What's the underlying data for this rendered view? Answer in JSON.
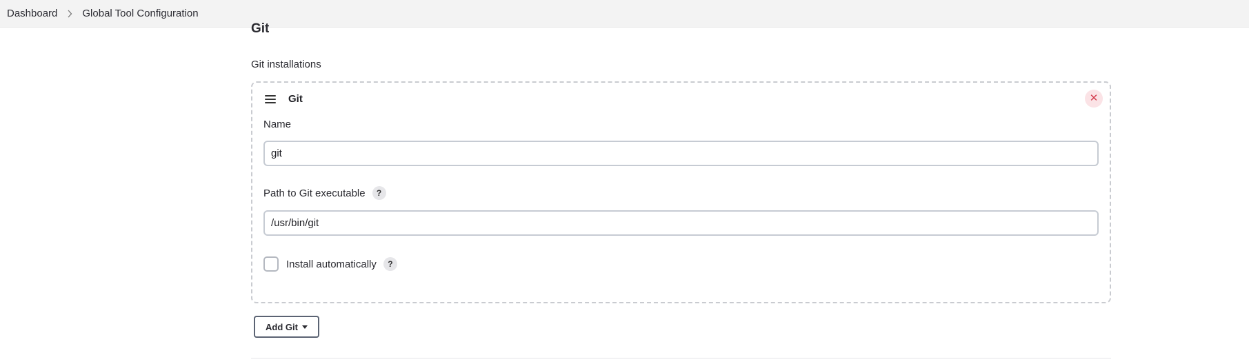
{
  "breadcrumb": {
    "items": [
      "Dashboard",
      "Global Tool Configuration"
    ]
  },
  "section": {
    "title": "Git",
    "installations_label": "Git installations"
  },
  "installation": {
    "title": "Git",
    "delete_symbol": "✕",
    "name_label": "Name",
    "name_value": "git",
    "path_label": "Path to Git executable",
    "path_value": "/usr/bin/git",
    "install_auto_label": "Install automatically",
    "install_auto_checked": false,
    "help_symbol": "?"
  },
  "actions": {
    "add_label": "Add Git"
  },
  "icons": {
    "drag": "drag-handle-icon",
    "delete": "close-icon",
    "help": "help-icon",
    "breadcrumb_separator": "chevron-right-icon",
    "dropdown": "caret-down-icon"
  },
  "colors": {
    "delete_bg": "#fbe3e6",
    "delete_fg": "#d33c4d",
    "border_dashed": "#c9cbd0",
    "input_border": "#c6cbd3",
    "button_border": "#5b6373"
  }
}
